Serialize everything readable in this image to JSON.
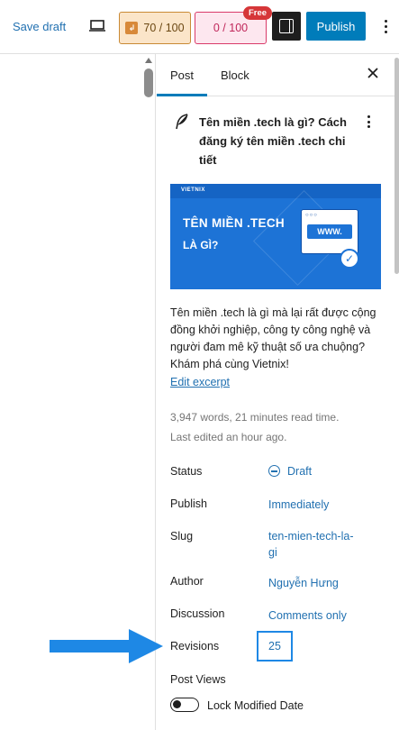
{
  "toolbar": {
    "save_draft": "Save draft",
    "seo_score": "70 / 100",
    "readability_score": "0 / 100",
    "free_badge": "Free",
    "publish": "Publish"
  },
  "sidebar": {
    "tabs": [
      {
        "label": "Post"
      },
      {
        "label": "Block"
      }
    ],
    "post_title": "Tên miền .tech là gì? Cách đăng ký tên miền .tech chi tiết",
    "featured_image": {
      "brand": "VIETNIX",
      "line1": "TÊN MIỀN .TECH",
      "line2": "LÀ GÌ?",
      "window_text": "WWW.",
      "window_dots": "○○○"
    },
    "excerpt": "Tên miền .tech là gì mà lại rất được cộng đồng khởi nghiệp, công ty công nghệ và người đam mê kỹ thuật số ưa chuộng? Khám phá cùng Vietnix!",
    "edit_excerpt": "Edit excerpt",
    "stats_words": "3,947 words, 21 minutes read time.",
    "stats_edited": "Last edited an hour ago.",
    "fields": {
      "status": {
        "label": "Status",
        "value": "Draft"
      },
      "publish": {
        "label": "Publish",
        "value": "Immediately"
      },
      "slug": {
        "label": "Slug",
        "value": "ten-mien-tech-la-gi"
      },
      "author": {
        "label": "Author",
        "value": "Nguyễn Hưng"
      },
      "discussion": {
        "label": "Discussion",
        "value": "Comments only"
      },
      "revisions": {
        "label": "Revisions",
        "value": "25"
      },
      "post_views": {
        "label": "Post Views"
      }
    },
    "lock_modified": {
      "label": "Lock Modified Date",
      "checked": false
    }
  },
  "colors": {
    "accent": "#007cba",
    "link": "#2271b1",
    "annotation": "#1e88e5"
  }
}
